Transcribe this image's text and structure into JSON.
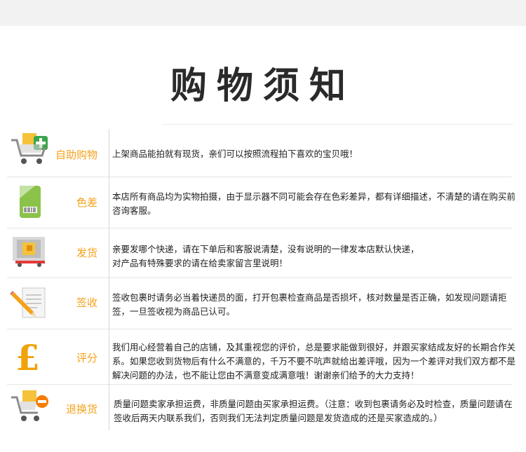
{
  "header": {
    "title": "购物须知"
  },
  "rows": [
    {
      "icon": "shopping-cart-add-icon",
      "label": "自助购物",
      "text": "上架商品能拍就有现货，亲们可以按照流程拍下喜欢的宝贝哦！"
    },
    {
      "icon": "price-tag-icon",
      "label": "色差",
      "text": "本店所有商品均为实物拍摄，由于显示器不同可能会存在色彩差异，都有详细描述，不清楚的请在购买前咨询客服。"
    },
    {
      "icon": "delivery-truck-icon",
      "label": "发货",
      "text": "亲要发哪个快递，请在下单后和客服说清楚，没有说明的一律发本店默认快递，\n对产品有特殊要求的请在给卖家留言里说明！"
    },
    {
      "icon": "document-pencil-icon",
      "label": "签收",
      "text": "签收包裹时请务必当着快递员的面，打开包裹检查商品是否损坏，核对数量是否正确，如发现问题请拒签，一旦签收视为商品已认可。"
    },
    {
      "icon": "pound-coin-icon",
      "label": "评分",
      "text": "我们用心经营着自己的店铺，及其重视您的评价，总是要求能做到很好，并跟买家结成友好的长期合作关系。如果您收到货物后有什么不满意的，千万不要不吭声就给出差评哦，因为一个差评对我们双方都不是解决问题的办法，也不能让您由不满意变成满意哦！谢谢亲们给予的大力支持！"
    },
    {
      "icon": "shopping-cart-remove-icon",
      "label": "退换货",
      "text": "质量问题卖家承担运费，非质量问题由买家承担运费。（注意：收到包裹请务必及时检查，质量问题请在签收后两天内联系我们，否则我们无法判定质量问题是发货造成的还是买家造成的。）"
    }
  ]
}
